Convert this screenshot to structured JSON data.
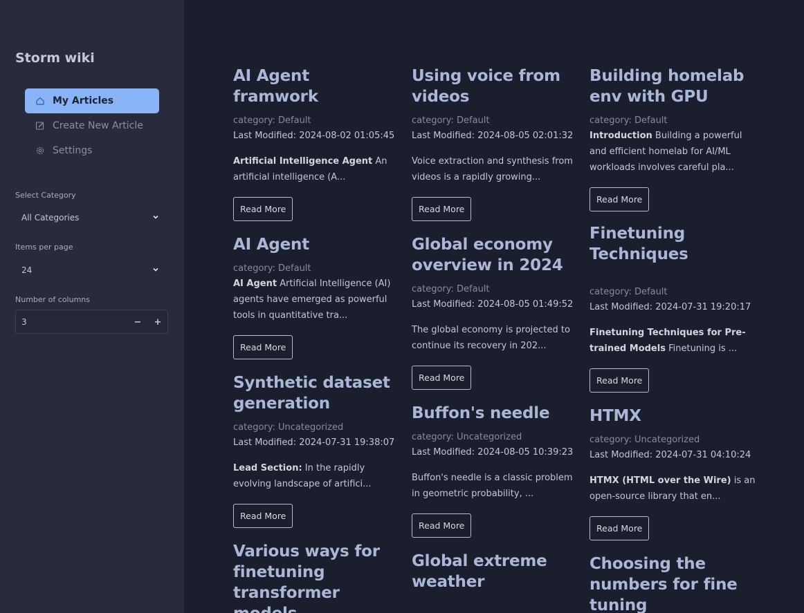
{
  "sidebar": {
    "title": "Storm wiki",
    "nav": [
      {
        "label": "My Articles",
        "icon": "home-icon",
        "active": true
      },
      {
        "label": "Create New Article",
        "icon": "edit-icon",
        "active": false
      },
      {
        "label": "Settings",
        "icon": "gear-icon",
        "active": false
      }
    ],
    "category_label": "Select Category",
    "category_value": "All Categories",
    "items_label": "Items per page",
    "items_value": "24",
    "columns_label": "Number of columns",
    "columns_value": "3",
    "minus": "−",
    "plus": "+"
  },
  "read_more": "Read More",
  "articles": {
    "col1": [
      {
        "title": "AI Agent framwork",
        "category": "category: Default",
        "modified": "Last Modified: 2024-08-02 01:05:45",
        "lead": "Artificial Intelligence Agent",
        "excerpt": " An artificial intelligence (A..."
      },
      {
        "title": "AI Agent",
        "category": "category: Default",
        "modified": "",
        "lead": "AI Agent",
        "excerpt": " Artificial Intelligence (AI) agents have emerged as powerful tools in quantitative tra..."
      },
      {
        "title": "Synthetic dataset generation",
        "category": "category: Uncategorized",
        "modified": "Last Modified: 2024-07-31 19:38:07",
        "lead": "Lead Section:",
        "excerpt": " In the rapidly evolving landscape of artifici..."
      },
      {
        "title": "Various ways for finetuning transformer models"
      }
    ],
    "col2": [
      {
        "title": "Using voice from videos",
        "category": "category: Default",
        "modified": "Last Modified: 2024-08-05 02:01:32",
        "lead": "",
        "excerpt": "Voice extraction and synthesis from videos is a rapidly growing..."
      },
      {
        "title": "Global economy overview in 2024",
        "category": "category: Default",
        "modified": "Last Modified: 2024-08-05 01:49:52",
        "lead": "",
        "excerpt": "The global economy is projected to continue its recovery in 202..."
      },
      {
        "title": "Buffon's needle",
        "category": "category: Uncategorized",
        "modified": "Last Modified: 2024-08-05 10:39:23",
        "lead": "",
        "excerpt": "Buffon's needle is a classic problem in geometric probability, ..."
      },
      {
        "title": "Global extreme weather"
      }
    ],
    "col3": [
      {
        "title": "Building homelab env with GPU",
        "category": "category: Default",
        "modified": "",
        "lead": "Introduction",
        "excerpt": " Building a powerful and efficient homelab for AI/ML workloads involves careful pla..."
      },
      {
        "title": "Finetuning Techniques",
        "category": "category: Default",
        "modified": "Last Modified: 2024-07-31 19:20:17",
        "lead": "Finetuning Techniques for Pre-trained Models",
        "excerpt": " Finetuning is ..."
      },
      {
        "title": "HTMX",
        "category": "category: Uncategorized",
        "modified": "Last Modified: 2024-07-31 04:10:24",
        "lead": "HTMX (HTML over the Wire)",
        "excerpt": " is an open-source library that en..."
      },
      {
        "title": "Choosing the numbers for fine tuning"
      }
    ]
  }
}
